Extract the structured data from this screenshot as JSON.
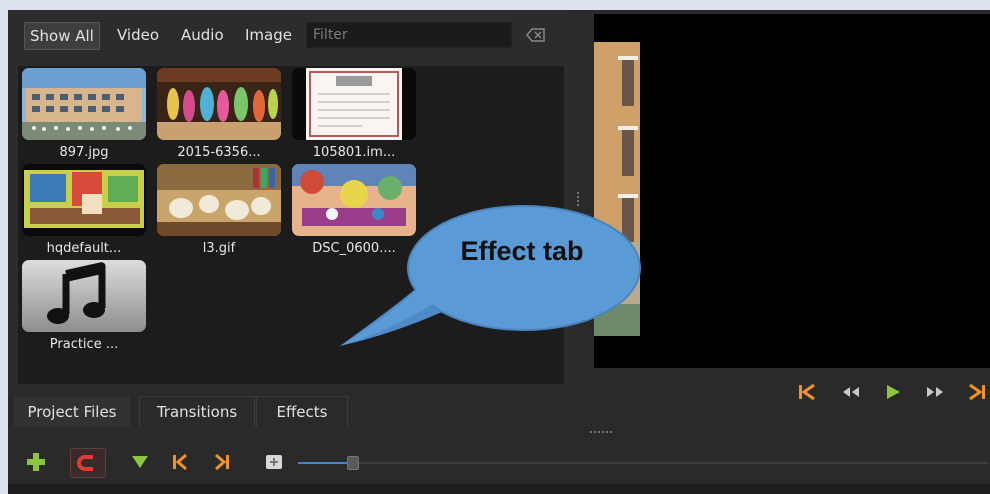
{
  "filter_bar": {
    "show_all": "Show All",
    "video": "Video",
    "audio": "Audio",
    "image": "Image",
    "filter_placeholder": "Filter"
  },
  "files": [
    {
      "label": "897.jpg",
      "thumb": "school-building"
    },
    {
      "label": "2015-6356...",
      "thumb": "dancers-stage"
    },
    {
      "label": "105801.im...",
      "thumb": "certificate"
    },
    {
      "label": "hqdefault...",
      "thumb": "classroom-drawing"
    },
    {
      "label": "l3.gif",
      "thumb": "library-room"
    },
    {
      "label": "DSC_0600....",
      "thumb": "craft-table"
    },
    {
      "label": "Practice ...",
      "thumb": "music-note-icon"
    }
  ],
  "tabs": {
    "project_files": "Project Files",
    "transitions": "Transitions",
    "effects": "Effects"
  },
  "callout": {
    "text": "Effect tab"
  },
  "player_controls": [
    "jump-start-icon",
    "rewind-icon",
    "play-icon",
    "fast-forward-icon",
    "jump-end-icon"
  ],
  "toolbar": [
    "add-track-icon",
    "snap-magnet-icon",
    "marker-icon",
    "previous-marker-icon",
    "next-marker-icon",
    "center-playhead-icon"
  ],
  "zoom_level": 0.08,
  "colors": {
    "accent_orange": "#f0922a",
    "accent_green": "#8cc63f",
    "accent_blue": "#3b84d6",
    "callout_blue": "#5b9bd5",
    "snap_red": "#e03a3a"
  }
}
